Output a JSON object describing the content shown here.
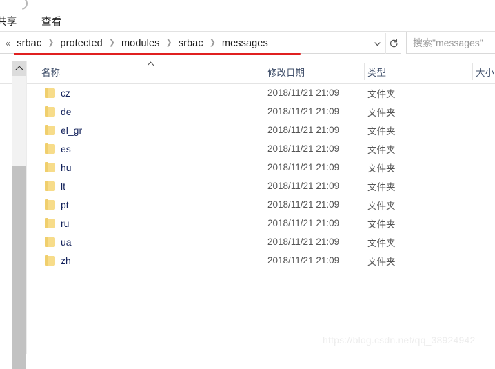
{
  "ribbon": {
    "tabs": [
      {
        "label": "共享",
        "name": "tab-share"
      },
      {
        "label": "查看",
        "name": "tab-view"
      }
    ]
  },
  "address": {
    "back_chevron": "«",
    "separator": "❯",
    "crumbs": [
      "srbac",
      "protected",
      "modules",
      "srbac",
      "messages"
    ],
    "dropdown_icon": "chevron-down-icon",
    "refresh_icon": "refresh-icon",
    "underline_color": "#e02020"
  },
  "search": {
    "placeholder": "搜索\"messages\"",
    "value": ""
  },
  "columns": {
    "name": "名称",
    "date": "修改日期",
    "type": "类型",
    "size": "大小",
    "sort_column": "名称",
    "sort_direction": "ascending"
  },
  "files": [
    {
      "name": "cz",
      "date": "2018/11/21 21:09",
      "type": "文件夹",
      "size": ""
    },
    {
      "name": "de",
      "date": "2018/11/21 21:09",
      "type": "文件夹",
      "size": ""
    },
    {
      "name": "el_gr",
      "date": "2018/11/21 21:09",
      "type": "文件夹",
      "size": ""
    },
    {
      "name": "es",
      "date": "2018/11/21 21:09",
      "type": "文件夹",
      "size": ""
    },
    {
      "name": "hu",
      "date": "2018/11/21 21:09",
      "type": "文件夹",
      "size": ""
    },
    {
      "name": "lt",
      "date": "2018/11/21 21:09",
      "type": "文件夹",
      "size": ""
    },
    {
      "name": "pt",
      "date": "2018/11/21 21:09",
      "type": "文件夹",
      "size": ""
    },
    {
      "name": "ru",
      "date": "2018/11/21 21:09",
      "type": "文件夹",
      "size": ""
    },
    {
      "name": "ua",
      "date": "2018/11/21 21:09",
      "type": "文件夹",
      "size": ""
    },
    {
      "name": "zh",
      "date": "2018/11/21 21:09",
      "type": "文件夹",
      "size": ""
    }
  ],
  "watermark": {
    "text": "https://blog.csdn.net/qq_38924942"
  }
}
